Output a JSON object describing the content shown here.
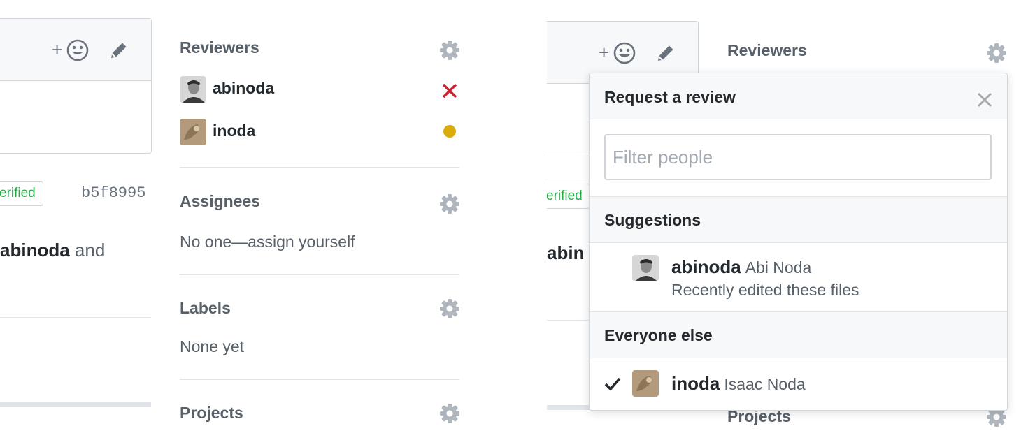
{
  "left": {
    "comment_toolbar": {
      "add_reaction_icon": "smiley-plus-icon",
      "edit_icon": "pencil-icon"
    },
    "commit": {
      "verified_label": "erified",
      "sha": "b5f8995"
    },
    "timeline_text": {
      "user": "abinoda",
      "rest": " and"
    },
    "sidebar": {
      "reviewers": {
        "title": "Reviewers",
        "items": [
          {
            "login": "abinoda",
            "status": "changes-requested",
            "status_color": "#cb2431"
          },
          {
            "login": "inoda",
            "status": "pending",
            "status_color": "#dbab09"
          }
        ]
      },
      "assignees": {
        "title": "Assignees",
        "empty": "No one—assign yourself"
      },
      "labels": {
        "title": "Labels",
        "empty": "None yet"
      },
      "projects": {
        "title": "Projects"
      }
    }
  },
  "right": {
    "commit": {
      "verified_label": "erified"
    },
    "timeline_text": {
      "user": "abin"
    },
    "sidebar": {
      "reviewers_title": "Reviewers",
      "projects_title": "Projects"
    },
    "popover": {
      "title": "Request a review",
      "close_icon": "close-icon",
      "filter_placeholder": "Filter people",
      "suggestions_header": "Suggestions",
      "suggestions": [
        {
          "login": "abinoda",
          "name": "Abi Noda",
          "reason": "Recently edited these files"
        }
      ],
      "everyone_header": "Everyone else",
      "everyone": [
        {
          "login": "inoda",
          "name": "Isaac Noda",
          "selected": true
        }
      ]
    }
  },
  "colors": {
    "accent_green": "#28a745",
    "danger": "#cb2431",
    "pending": "#dbab09",
    "muted": "#586069"
  }
}
